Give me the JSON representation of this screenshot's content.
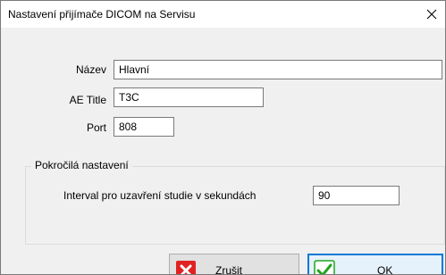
{
  "window": {
    "title": "Nastavení přijímače DICOM na Servisu"
  },
  "form": {
    "name": {
      "label": "Název",
      "value": "Hlavní"
    },
    "ae_title": {
      "label": "AE Title",
      "value": "T3C"
    },
    "port": {
      "label": "Port",
      "value": "808"
    }
  },
  "advanced": {
    "group_title": "Pokročilá nastavení",
    "interval": {
      "label": "Interval pro uzavření studie v sekundách",
      "value": "90"
    }
  },
  "buttons": {
    "cancel_label": "Zrušit",
    "ok_label": "OK"
  },
  "icons": {
    "close": "close-icon",
    "cancel": "red-x-icon",
    "ok": "green-check-icon"
  },
  "colors": {
    "ok_border": "#0078d7",
    "cancel_icon": "#e02222",
    "ok_icon": "#1fa51f"
  }
}
